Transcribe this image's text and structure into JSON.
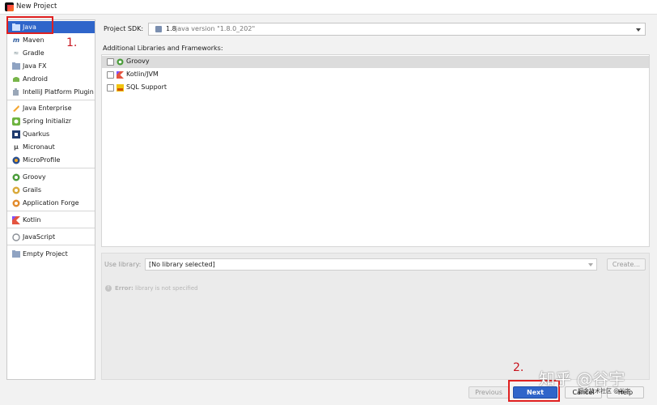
{
  "window": {
    "title": "New Project"
  },
  "sidebar": {
    "items": [
      {
        "label": "Java",
        "icon": "folder-icon",
        "selected": true
      },
      {
        "label": "Maven",
        "icon": "maven-icon"
      },
      {
        "label": "Gradle",
        "icon": "gradle-icon"
      },
      {
        "label": "Java FX",
        "icon": "folder-icon"
      },
      {
        "label": "Android",
        "icon": "android-icon"
      },
      {
        "label": "IntelliJ Platform Plugin",
        "icon": "plugin-icon"
      },
      {
        "label": "Java Enterprise",
        "icon": "java-enterprise-icon"
      },
      {
        "label": "Spring Initializr",
        "icon": "spring-icon"
      },
      {
        "label": "Quarkus",
        "icon": "quarkus-icon"
      },
      {
        "label": "Micronaut",
        "icon": "micronaut-icon"
      },
      {
        "label": "MicroProfile",
        "icon": "microprofile-icon"
      },
      {
        "label": "Groovy",
        "icon": "groovy-icon"
      },
      {
        "label": "Grails",
        "icon": "grails-icon"
      },
      {
        "label": "Application Forge",
        "icon": "application-forge-icon"
      },
      {
        "label": "Kotlin",
        "icon": "kotlin-icon"
      },
      {
        "label": "JavaScript",
        "icon": "javascript-icon"
      },
      {
        "label": "Empty Project",
        "icon": "folder-icon"
      }
    ]
  },
  "sdk": {
    "label": "Project SDK:",
    "version": "1.8",
    "detail": "java version \"1.8.0_202\""
  },
  "libraries": {
    "label": "Additional Libraries and Frameworks:",
    "items": [
      {
        "label": "Groovy",
        "icon": "groovy-icon",
        "checked": false
      },
      {
        "label": "Kotlin/JVM",
        "icon": "kotlin-icon",
        "checked": false
      },
      {
        "label": "SQL Support",
        "icon": "sql-icon",
        "checked": false
      }
    ]
  },
  "use_library": {
    "label": "Use library:",
    "value": "[No library selected]",
    "create_label": "Create..."
  },
  "error": {
    "prefix": "Error:",
    "message": "library is not specified"
  },
  "buttons": {
    "previous": "Previous",
    "next": "Next",
    "cancel": "Cancel",
    "help": "Help"
  },
  "annotations": {
    "step1": "1.",
    "step2": "2."
  },
  "watermark": {
    "large": "知乎 @谷宇",
    "small": "掘金技术社区 @谷宇"
  },
  "colors": {
    "selection": "#2f65ca",
    "annotation": "#e02020",
    "groovy": "#4a9c3a",
    "kotlin": "#e4543f"
  }
}
